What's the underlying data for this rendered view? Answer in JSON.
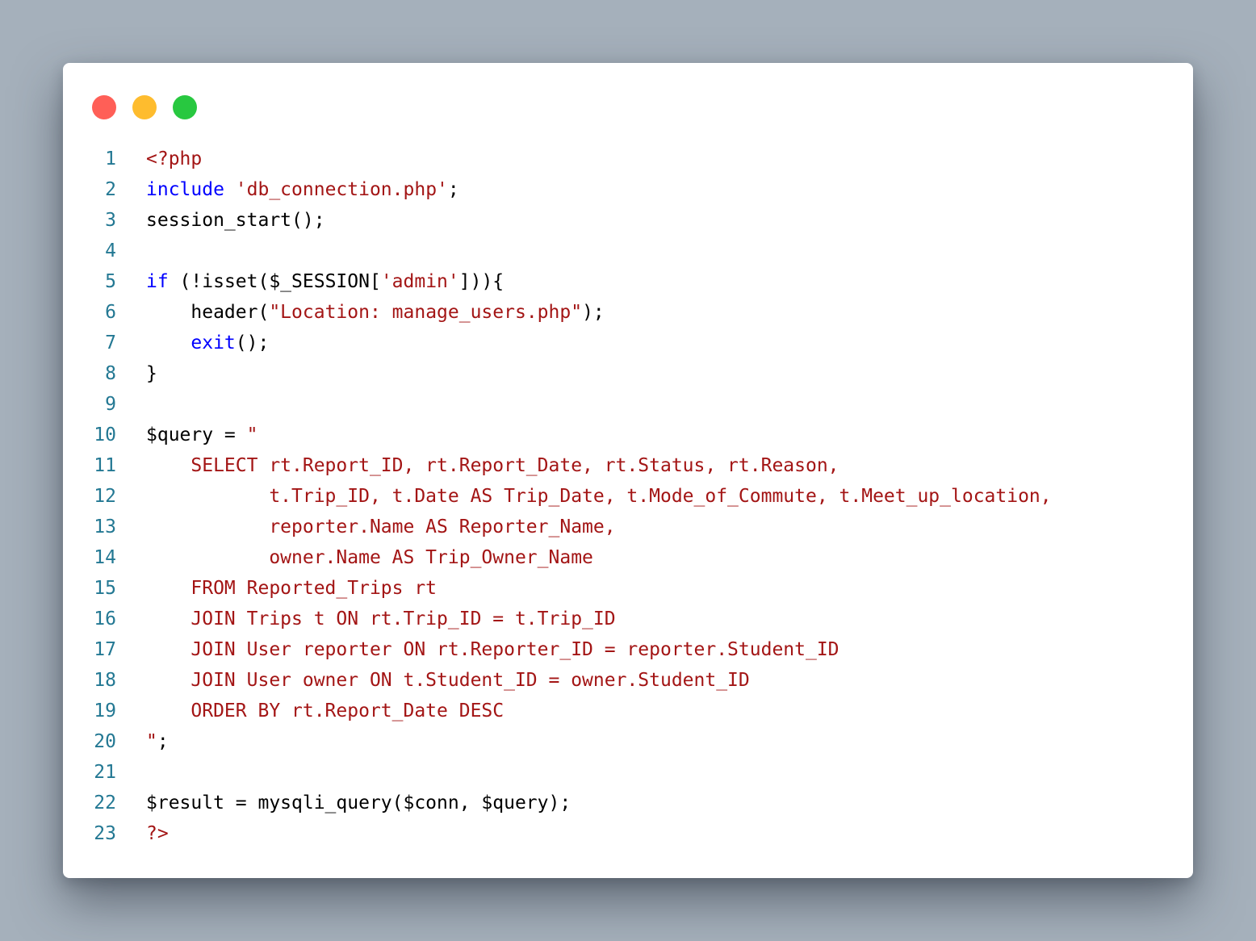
{
  "window": {
    "controls": [
      {
        "name": "close-dot",
        "color": "#ff5f57"
      },
      {
        "name": "minimize-dot",
        "color": "#febc2e"
      },
      {
        "name": "maximize-dot",
        "color": "#28c840"
      }
    ]
  },
  "colors": {
    "keyword": "#0000ff",
    "string": "#a31515",
    "default": "#000000",
    "line_number": "#237893"
  },
  "code": {
    "lines": [
      {
        "n": "1",
        "tokens": [
          {
            "t": "<?php",
            "c": "string"
          }
        ]
      },
      {
        "n": "2",
        "tokens": [
          {
            "t": "include",
            "c": "keyword"
          },
          {
            "t": " ",
            "c": "default"
          },
          {
            "t": "'db_connection.php'",
            "c": "string"
          },
          {
            "t": ";",
            "c": "default"
          }
        ]
      },
      {
        "n": "3",
        "tokens": [
          {
            "t": "session_start();",
            "c": "default"
          }
        ]
      },
      {
        "n": "4",
        "tokens": []
      },
      {
        "n": "5",
        "tokens": [
          {
            "t": "if",
            "c": "keyword"
          },
          {
            "t": " (!isset($_SESSION[",
            "c": "default"
          },
          {
            "t": "'admin'",
            "c": "string"
          },
          {
            "t": "])){",
            "c": "default"
          }
        ]
      },
      {
        "n": "6",
        "tokens": [
          {
            "t": "    header(",
            "c": "default"
          },
          {
            "t": "\"Location: manage_users.php\"",
            "c": "string"
          },
          {
            "t": ");",
            "c": "default"
          }
        ]
      },
      {
        "n": "7",
        "tokens": [
          {
            "t": "    ",
            "c": "default"
          },
          {
            "t": "exit",
            "c": "keyword"
          },
          {
            "t": "();",
            "c": "default"
          }
        ]
      },
      {
        "n": "8",
        "tokens": [
          {
            "t": "}",
            "c": "default"
          }
        ]
      },
      {
        "n": "9",
        "tokens": []
      },
      {
        "n": "10",
        "tokens": [
          {
            "t": "$query = ",
            "c": "default"
          },
          {
            "t": "\"",
            "c": "string"
          }
        ]
      },
      {
        "n": "11",
        "tokens": [
          {
            "t": "    SELECT rt.Report_ID, rt.Report_Date, rt.Status, rt.Reason,",
            "c": "string"
          }
        ]
      },
      {
        "n": "12",
        "tokens": [
          {
            "t": "           t.Trip_ID, t.Date AS Trip_Date, t.Mode_of_Commute, t.Meet_up_location,",
            "c": "string"
          }
        ]
      },
      {
        "n": "13",
        "tokens": [
          {
            "t": "           reporter.Name AS Reporter_Name,",
            "c": "string"
          }
        ]
      },
      {
        "n": "14",
        "tokens": [
          {
            "t": "           owner.Name AS Trip_Owner_Name",
            "c": "string"
          }
        ]
      },
      {
        "n": "15",
        "tokens": [
          {
            "t": "    FROM Reported_Trips rt",
            "c": "string"
          }
        ]
      },
      {
        "n": "16",
        "tokens": [
          {
            "t": "    JOIN Trips t ON rt.Trip_ID = t.Trip_ID",
            "c": "string"
          }
        ]
      },
      {
        "n": "17",
        "tokens": [
          {
            "t": "    JOIN User reporter ON rt.Reporter_ID = reporter.Student_ID",
            "c": "string"
          }
        ]
      },
      {
        "n": "18",
        "tokens": [
          {
            "t": "    JOIN User owner ON t.Student_ID = owner.Student_ID",
            "c": "string"
          }
        ]
      },
      {
        "n": "19",
        "tokens": [
          {
            "t": "    ORDER BY rt.Report_Date DESC",
            "c": "string"
          }
        ]
      },
      {
        "n": "20",
        "tokens": [
          {
            "t": "\"",
            "c": "string"
          },
          {
            "t": ";",
            "c": "default"
          }
        ]
      },
      {
        "n": "21",
        "tokens": []
      },
      {
        "n": "22",
        "tokens": [
          {
            "t": "$result = mysqli_query($conn, $query);",
            "c": "default"
          }
        ]
      },
      {
        "n": "23",
        "tokens": [
          {
            "t": "?>",
            "c": "string"
          }
        ]
      }
    ]
  }
}
